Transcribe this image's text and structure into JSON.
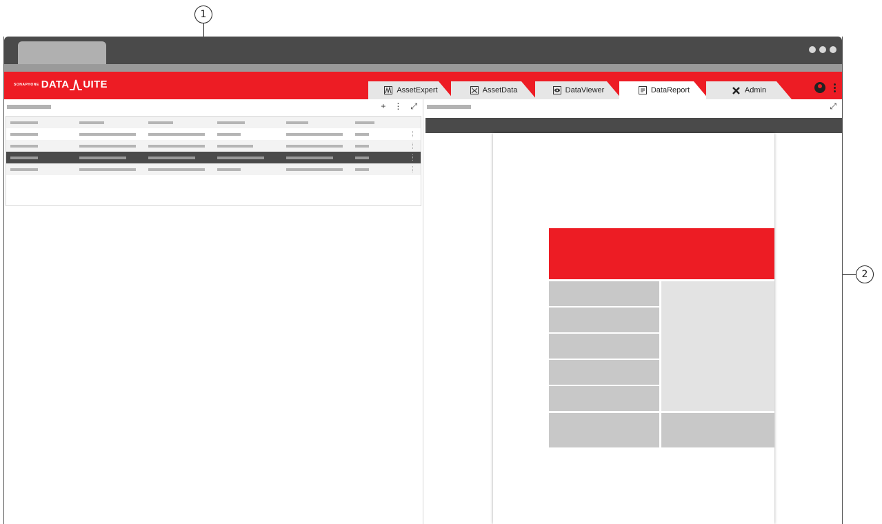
{
  "callouts": {
    "one": "1",
    "two": "2"
  },
  "app": {
    "logo_small": "SONAPHONE",
    "logo_big_1": "DATA",
    "logo_big_2": "UITE"
  },
  "tabs": [
    {
      "label": "AssetExpert",
      "icon": "asset-expert-icon",
      "active": false
    },
    {
      "label": "AssetData",
      "icon": "asset-data-icon",
      "active": false
    },
    {
      "label": "DataViewer",
      "icon": "eye-icon",
      "active": false
    },
    {
      "label": "DataReport",
      "icon": "report-icon",
      "active": true
    },
    {
      "label": "Admin",
      "icon": "tools-icon",
      "active": false
    }
  ],
  "left_panel": {
    "tools": {
      "add": "+",
      "more": "⋮",
      "expand": "⤢"
    }
  },
  "right_panel": {
    "tools": {
      "expand": "⤢"
    }
  },
  "colors": {
    "brand_red": "#ed1c24",
    "chrome_dark": "#4a4a4a",
    "placeholder_grey": "#b5b5b5"
  }
}
